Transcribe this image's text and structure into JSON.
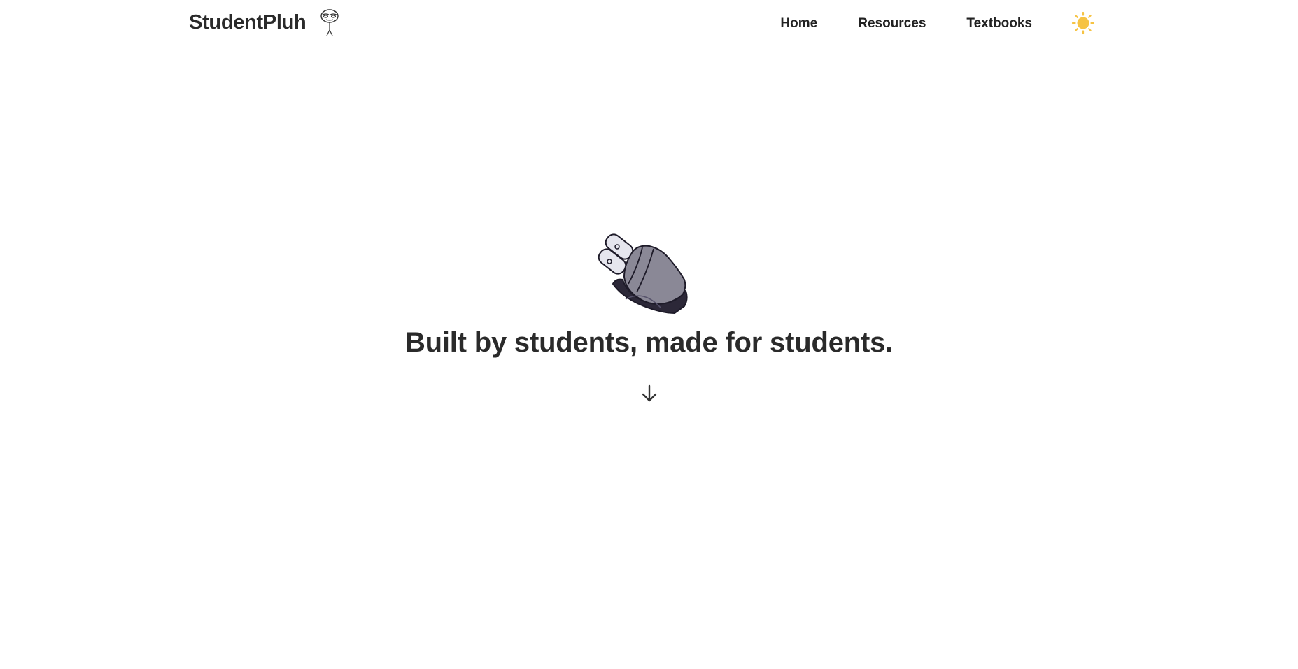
{
  "header": {
    "brand": "StudentPluh",
    "mascot_icon": "stick-figure-mascot-icon",
    "nav": [
      {
        "label": "Home"
      },
      {
        "label": "Resources"
      },
      {
        "label": "Textbooks"
      }
    ],
    "theme_toggle_icon": "sun-icon"
  },
  "hero": {
    "illustration_icon": "power-plug-icon",
    "title": "Built by students, made for students.",
    "scroll_icon": "arrow-down-icon"
  },
  "colors": {
    "text": "#2a2a2a",
    "sun": "#f6c343",
    "plug_body": "#8a8896",
    "plug_dark": "#2c2838",
    "plug_prongs": "#e6e6ee",
    "background": "#ffffff"
  }
}
